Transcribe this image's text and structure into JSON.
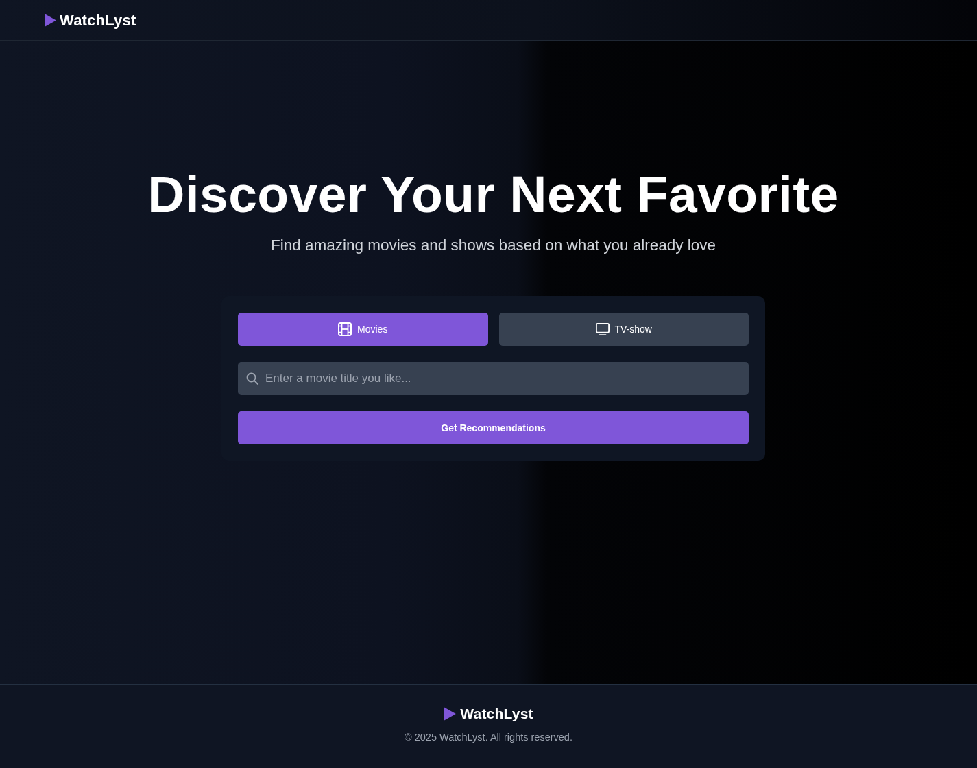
{
  "header": {
    "logo": "WatchLyst"
  },
  "hero": {
    "title": "Discover Your Next Favorite",
    "subtitle": "Find amazing movies and shows based on what you already love"
  },
  "search_card": {
    "tabs": [
      {
        "label": "Movies",
        "kind": "film",
        "selected": true
      },
      {
        "label": "TV-show",
        "kind": "tv",
        "selected": false
      }
    ],
    "search": {
      "placeholder": "Enter a movie title you like..."
    },
    "submit": "Get Recommendations"
  },
  "footer": {
    "logo": "WatchLyst",
    "copyright": "© 2025 WatchLyst. All rights reserved."
  }
}
